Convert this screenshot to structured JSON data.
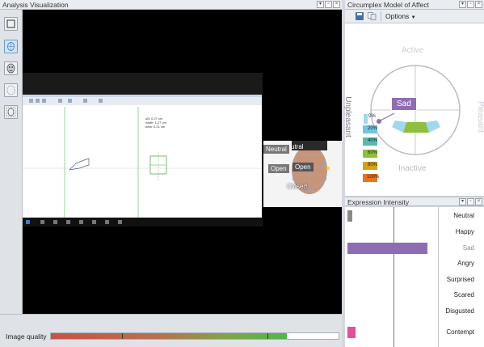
{
  "analysis_panel": {
    "title": "Analysis Visualization",
    "toolbar_icons": [
      "square-icon",
      "face-grid-icon",
      "face-mask-icon",
      "face-outline-icon",
      "face-points-icon"
    ]
  },
  "overlay_labels": {
    "neutral": "Neutral",
    "neutral_partial": "utral",
    "open_left": "Open",
    "open_right": "Open",
    "closed": "Closed"
  },
  "screen_text": {
    "dimension_block": "uB: 0.27 cm\nwidth: 1.27 cm\nbeta: 0.21 cm"
  },
  "image_quality": {
    "label": "Image quality",
    "value_fraction": 0.82
  },
  "circumplex_panel": {
    "title": "Circumplex Model of Affect",
    "options_label": "Options",
    "active": "Active",
    "inactive": "Inactive",
    "unpleasant": "Unpleasant",
    "pleasant": "Pleasant",
    "current_emotion": "Sad",
    "legend": [
      "0%",
      "20%",
      "40%",
      "60%",
      "80%",
      "100%"
    ],
    "legend_colors": [
      "#9fd8ef",
      "#6fc4e8",
      "#59b8b0",
      "#8fbf3c",
      "#d6a01b",
      "#e8741e"
    ]
  },
  "expression_panel": {
    "title": "Expression Intensity",
    "rows": [
      {
        "label": "Neutral",
        "value": 0.04,
        "color": "#8a8a8a"
      },
      {
        "label": "Happy",
        "value": 0,
        "color": "#f2c400"
      },
      {
        "label": "Sad",
        "value": 0.62,
        "color": "#8f6db5"
      },
      {
        "label": "Angry",
        "value": 0,
        "color": "#d13b2c"
      },
      {
        "label": "Surprised",
        "value": 0,
        "color": "#f0a020"
      },
      {
        "label": "Scared",
        "value": 0,
        "color": "#2f8a3b"
      },
      {
        "label": "Disgusted",
        "value": 0,
        "color": "#4a8ad1"
      },
      {
        "label": "Contempt",
        "value": 0.06,
        "color": "#e44e9c"
      }
    ]
  }
}
